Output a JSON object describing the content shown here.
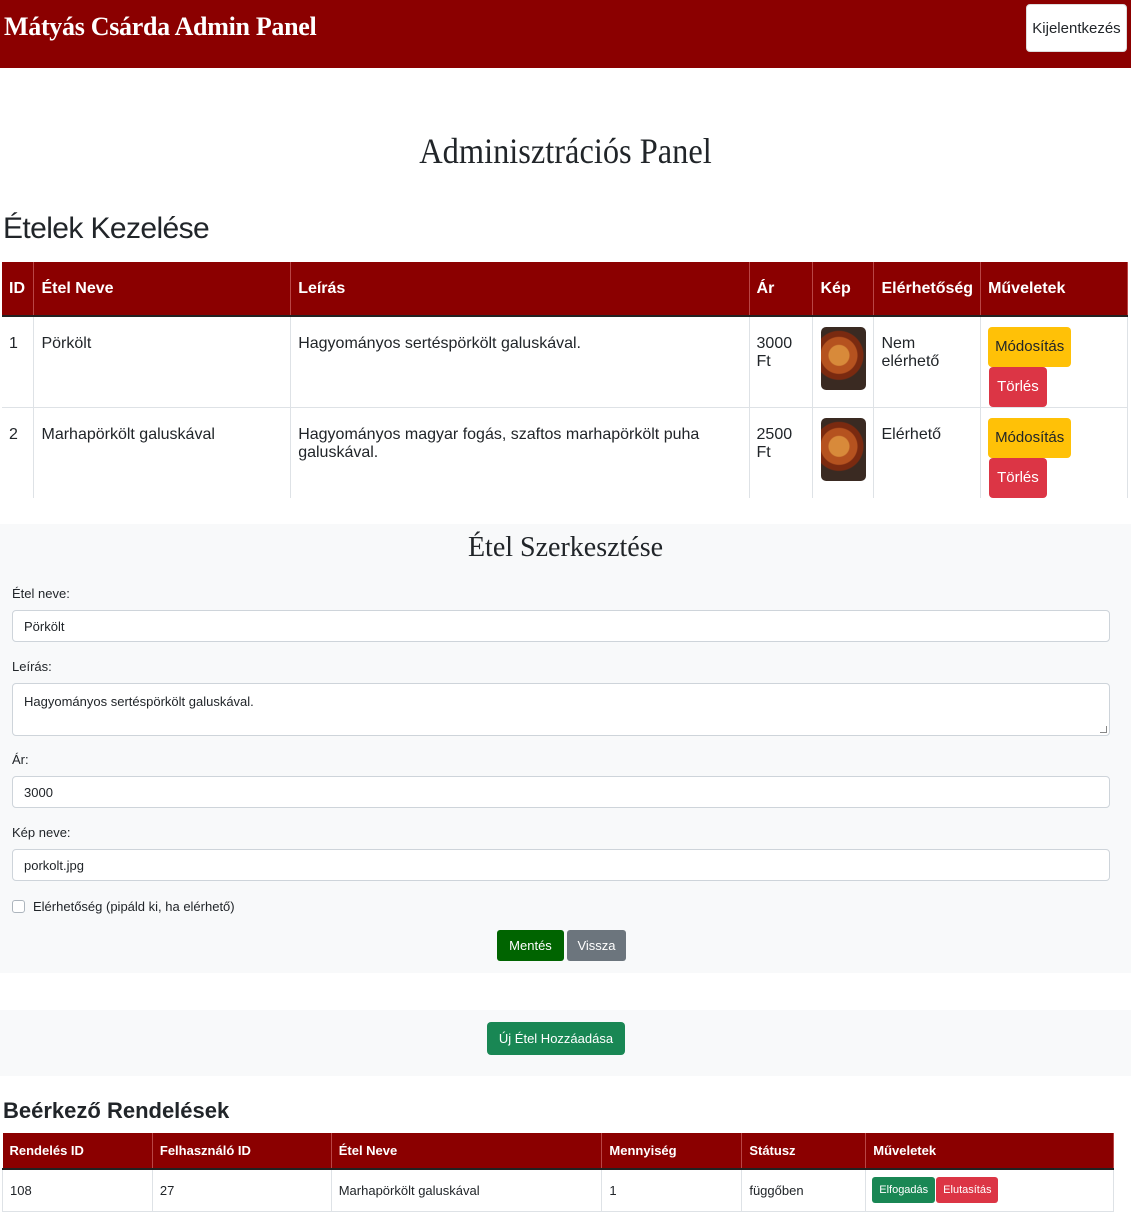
{
  "navbar": {
    "brand": "Mátyás Csárda Admin Panel",
    "logout_label": "Kijelentkezés"
  },
  "page_title": "Adminisztrációs Panel",
  "foods_section": {
    "title": "Ételek Kezelése",
    "headers": [
      "ID",
      "Étel Neve",
      "Leírás",
      "Ár",
      "Kép",
      "Elérhetőség",
      "Műveletek"
    ],
    "rows": [
      {
        "id": "1",
        "name": "Pörkölt",
        "description": "Hagyományos sertéspörkölt galuskával.",
        "price": "3000 Ft",
        "image": "dish-photo",
        "availability": "Nem elérhető",
        "edit_label": "Módosítás",
        "delete_label": "Törlés"
      },
      {
        "id": "2",
        "name": "Marhapörkölt galuskával",
        "description": "Hagyományos magyar fogás, szaftos marhapörkölt puha galuskával.",
        "price": "2500 Ft",
        "image": "dish-photo",
        "availability": "Elérhető",
        "edit_label": "Módosítás",
        "delete_label": "Törlés"
      }
    ]
  },
  "edit_form": {
    "title": "Étel Szerkesztése",
    "name_label": "Étel neve:",
    "name_value": "Pörkölt",
    "desc_label": "Leírás:",
    "desc_value": "Hagyományos sertéspörkölt galuskával.",
    "price_label": "Ár:",
    "price_value": "3000",
    "image_label": "Kép neve:",
    "image_value": "porkolt.jpg",
    "availability_label": "Elérhetőség (pipáld ki, ha elérhető)",
    "availability_checked": false,
    "save_label": "Mentés",
    "back_label": "Vissza"
  },
  "add_button_label": "Új Étel Hozzáadása",
  "orders_section": {
    "title": "Beérkező Rendelések",
    "headers": [
      "Rendelés ID",
      "Felhasználó ID",
      "Étel Neve",
      "Mennyiség",
      "Státusz",
      "Műveletek"
    ],
    "rows": [
      {
        "order_id": "108",
        "user_id": "27",
        "food_name": "Marhapörkölt galuskával",
        "quantity": "1",
        "status": "függőben",
        "accept_label": "Elfogadás",
        "reject_label": "Elutasítás"
      }
    ]
  },
  "colors": {
    "brand": "#8b0000",
    "warning": "#ffc107",
    "danger": "#dc3545",
    "success": "#198754",
    "save": "#006400",
    "secondary": "#6c757d"
  }
}
